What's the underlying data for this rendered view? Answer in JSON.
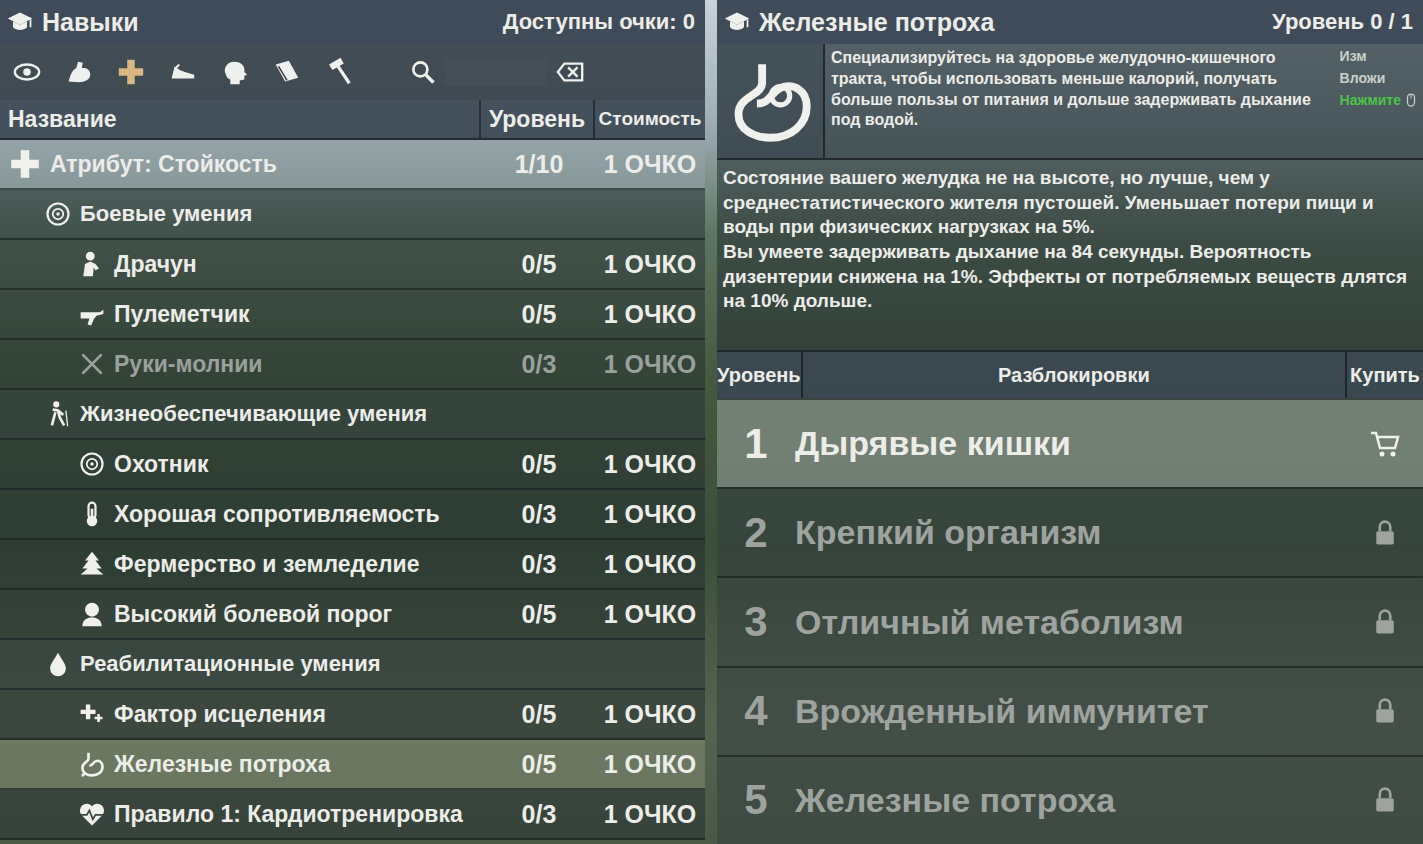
{
  "skills": {
    "title": "Навыки",
    "points": "Доступны очки: 0",
    "categories": [
      {
        "selected": false
      },
      {
        "selected": false
      },
      {
        "selected": true
      },
      {
        "selected": false
      },
      {
        "selected": false
      },
      {
        "selected": false
      },
      {
        "selected": false
      }
    ],
    "search": {
      "value": ""
    },
    "columns": [
      "Название",
      "Уровень",
      "Стоимость"
    ],
    "rows": [
      {
        "kind": "attribute",
        "name": "Атрибут: Стойкость",
        "level": "1/10",
        "cost": "1 ОЧКО",
        "selected": false,
        "disabled": false
      },
      {
        "kind": "category",
        "name": "Боевые умения",
        "selected": false,
        "disabled": false
      },
      {
        "kind": "skill",
        "name": "Драчун",
        "level": "0/5",
        "cost": "1 ОЧКО",
        "selected": false,
        "disabled": false
      },
      {
        "kind": "skill",
        "name": "Пулеметчик",
        "level": "0/5",
        "cost": "1 ОЧКО",
        "selected": false,
        "disabled": false
      },
      {
        "kind": "skill",
        "name": "Руки-молнии",
        "level": "0/3",
        "cost": "1 ОЧКО",
        "selected": false,
        "disabled": true
      },
      {
        "kind": "category",
        "name": "Жизнеобеспечивающие умения",
        "selected": false,
        "disabled": false
      },
      {
        "kind": "skill",
        "name": "Охотник",
        "level": "0/5",
        "cost": "1 ОЧКО",
        "selected": false,
        "disabled": false
      },
      {
        "kind": "skill",
        "name": "Хорошая сопротивляемость",
        "level": "0/3",
        "cost": "1 ОЧКО",
        "selected": false,
        "disabled": false
      },
      {
        "kind": "skill",
        "name": "Фермерство и земледелие",
        "level": "0/3",
        "cost": "1 ОЧКО",
        "selected": false,
        "disabled": false
      },
      {
        "kind": "skill",
        "name": "Высокий болевой порог",
        "level": "0/5",
        "cost": "1 ОЧКО",
        "selected": false,
        "disabled": false
      },
      {
        "kind": "category",
        "name": "Реабилитационные умения",
        "selected": false,
        "disabled": false
      },
      {
        "kind": "skill",
        "name": "Фактор исцеления",
        "level": "0/5",
        "cost": "1 ОЧКО",
        "selected": false,
        "disabled": false
      },
      {
        "kind": "skill",
        "name": "Железные потроха",
        "level": "0/5",
        "cost": "1 ОЧКО",
        "selected": true,
        "disabled": false
      },
      {
        "kind": "skill",
        "name": "Правило 1: Кардиотренировка",
        "level": "0/3",
        "cost": "1 ОЧКО",
        "selected": false,
        "disabled": false
      }
    ]
  },
  "detail": {
    "title": "Железные потроха",
    "level": "Уровень 0 / 1",
    "summary": "Специализируйтесь на здоровье желудочно-кишечного тракта, чтобы использовать меньше калорий, получать больше пользы от питания и дольше задерживать дыхание под водой.",
    "hints": [
      "Изм",
      "Вложи",
      "Нажмите"
    ],
    "description": [
      "Состояние вашего желудка не на высоте, но лучше, чем у среднестатистического жителя пустошей. Уменьшает потери пищи и воды при физических нагрузках на 5%.",
      "Вы умеете задерживать дыхание на 84 секунды. Вероятность дизентерии снижена на 1%. Эффекты от потребляемых веществ длятся на 10% дольше."
    ],
    "columns": [
      "Уровень",
      "Разблокировки",
      "Купить"
    ],
    "perks": [
      {
        "level": "1",
        "name": "Дырявые кишки",
        "selected": true,
        "locked": false
      },
      {
        "level": "2",
        "name": "Крепкий организм",
        "selected": false,
        "locked": true
      },
      {
        "level": "3",
        "name": "Отличный метаболизм",
        "selected": false,
        "locked": true
      },
      {
        "level": "4",
        "name": "Врожденный иммунитет",
        "selected": false,
        "locked": true
      },
      {
        "level": "5",
        "name": "Железные потроха",
        "selected": false,
        "locked": true
      }
    ]
  }
}
